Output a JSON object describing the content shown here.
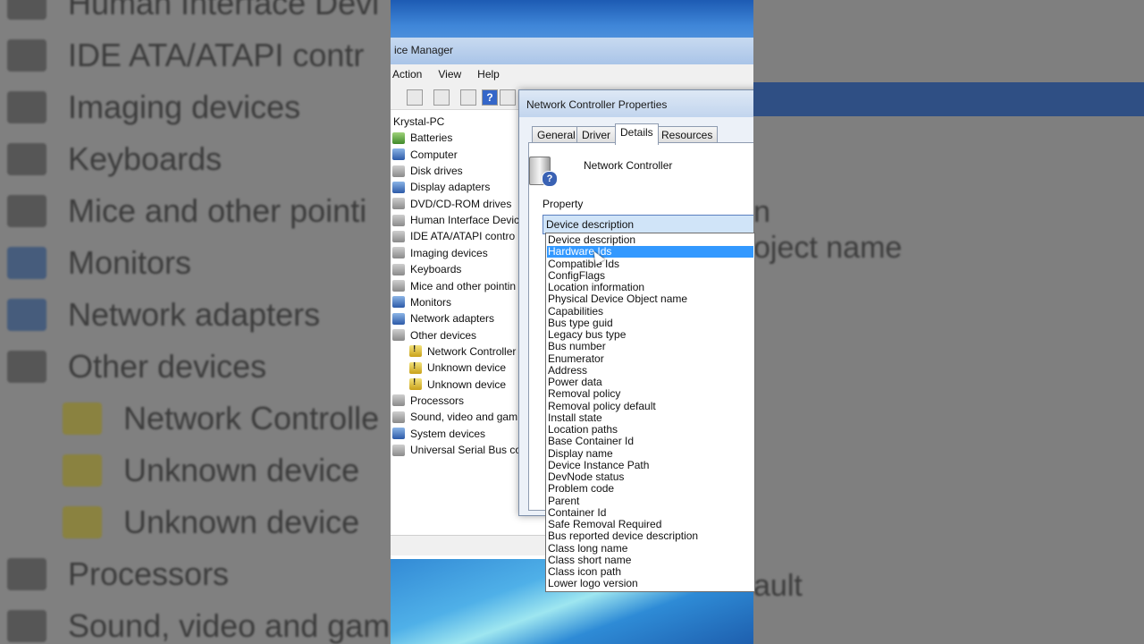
{
  "background_left": {
    "rows": [
      {
        "label": "Human Interface Devi",
        "icon": "hid-icon",
        "indent": false
      },
      {
        "label": "IDE ATA/ATAPI contr",
        "icon": "ide-icon",
        "indent": false
      },
      {
        "label": "Imaging devices",
        "icon": "camera-icon",
        "indent": false
      },
      {
        "label": "Keyboards",
        "icon": "keyboard-icon",
        "indent": false
      },
      {
        "label": "Mice and other pointi",
        "icon": "mouse-icon",
        "indent": false
      },
      {
        "label": "Monitors",
        "icon": "monitor-icon",
        "indent": false
      },
      {
        "label": "Network adapters",
        "icon": "network-icon",
        "indent": false
      },
      {
        "label": "Other devices",
        "icon": "other-devices-icon",
        "indent": false
      },
      {
        "label": "Network Controlle",
        "icon": "warning-icon",
        "indent": true
      },
      {
        "label": "Unknown device",
        "icon": "warning-icon",
        "indent": true
      },
      {
        "label": "Unknown device",
        "icon": "warning-icon",
        "indent": true
      },
      {
        "label": "Processors",
        "icon": "processor-icon",
        "indent": false
      },
      {
        "label": "Sound, video and gam",
        "icon": "sound-icon",
        "indent": false
      }
    ]
  },
  "background_right": {
    "texts": [
      "n",
      "oject name",
      "ault"
    ]
  },
  "device_manager": {
    "title": "ice Manager",
    "menus": [
      "Action",
      "View",
      "Help"
    ],
    "tree": [
      {
        "label": "Krystal-PC",
        "icon": "computer-root-icon",
        "level": 0
      },
      {
        "label": "Batteries",
        "icon": "battery-icon",
        "level": 1
      },
      {
        "label": "Computer",
        "icon": "computer-icon",
        "level": 1
      },
      {
        "label": "Disk drives",
        "icon": "disk-icon",
        "level": 1
      },
      {
        "label": "Display adapters",
        "icon": "display-icon",
        "level": 1
      },
      {
        "label": "DVD/CD-ROM drives",
        "icon": "dvd-icon",
        "level": 1
      },
      {
        "label": "Human Interface Devic",
        "icon": "hid-icon",
        "level": 1
      },
      {
        "label": "IDE ATA/ATAPI contro",
        "icon": "ide-icon",
        "level": 1
      },
      {
        "label": "Imaging devices",
        "icon": "camera-icon",
        "level": 1
      },
      {
        "label": "Keyboards",
        "icon": "keyboard-icon",
        "level": 1
      },
      {
        "label": "Mice and other pointin",
        "icon": "mouse-icon",
        "level": 1
      },
      {
        "label": "Monitors",
        "icon": "monitor-icon",
        "level": 1
      },
      {
        "label": "Network adapters",
        "icon": "network-icon",
        "level": 1
      },
      {
        "label": "Other devices",
        "icon": "other-devices-icon",
        "level": 1
      },
      {
        "label": "Network Controller",
        "icon": "warning-icon",
        "level": 2
      },
      {
        "label": "Unknown device",
        "icon": "warning-icon",
        "level": 2
      },
      {
        "label": "Unknown device",
        "icon": "warning-icon",
        "level": 2
      },
      {
        "label": "Processors",
        "icon": "processor-icon",
        "level": 1
      },
      {
        "label": "Sound, video and gam",
        "icon": "sound-icon",
        "level": 1
      },
      {
        "label": "System devices",
        "icon": "system-icon",
        "level": 1
      },
      {
        "label": "Universal Serial Bus co",
        "icon": "usb-icon",
        "level": 1
      }
    ]
  },
  "properties_dialog": {
    "title": "Network Controller Properties",
    "tabs": [
      "General",
      "Driver",
      "Details",
      "Resources"
    ],
    "active_tab": "Details",
    "device_name": "Network Controller",
    "property_label": "Property",
    "selected_property": "Device description",
    "options": [
      "Device description",
      "Hardware Ids",
      "Compatible Ids",
      "ConfigFlags",
      "Location information",
      "Physical Device Object name",
      "Capabilities",
      "Bus type guid",
      "Legacy bus type",
      "Bus number",
      "Enumerator",
      "Address",
      "Power data",
      "Removal policy",
      "Removal policy default",
      "Install state",
      "Location paths",
      "Base Container Id",
      "Display name",
      "Device Instance Path",
      "DevNode status",
      "Problem code",
      "Parent",
      "Container Id",
      "Safe Removal Required",
      "Bus reported device description",
      "Class long name",
      "Class short name",
      "Class icon path",
      "Lower logo version"
    ],
    "highlighted_option": "Hardware Ids"
  },
  "colors": {
    "selection": "#3399ff",
    "titlebar": "#1d5bb3",
    "dialog_bg": "#ecf1f8"
  }
}
